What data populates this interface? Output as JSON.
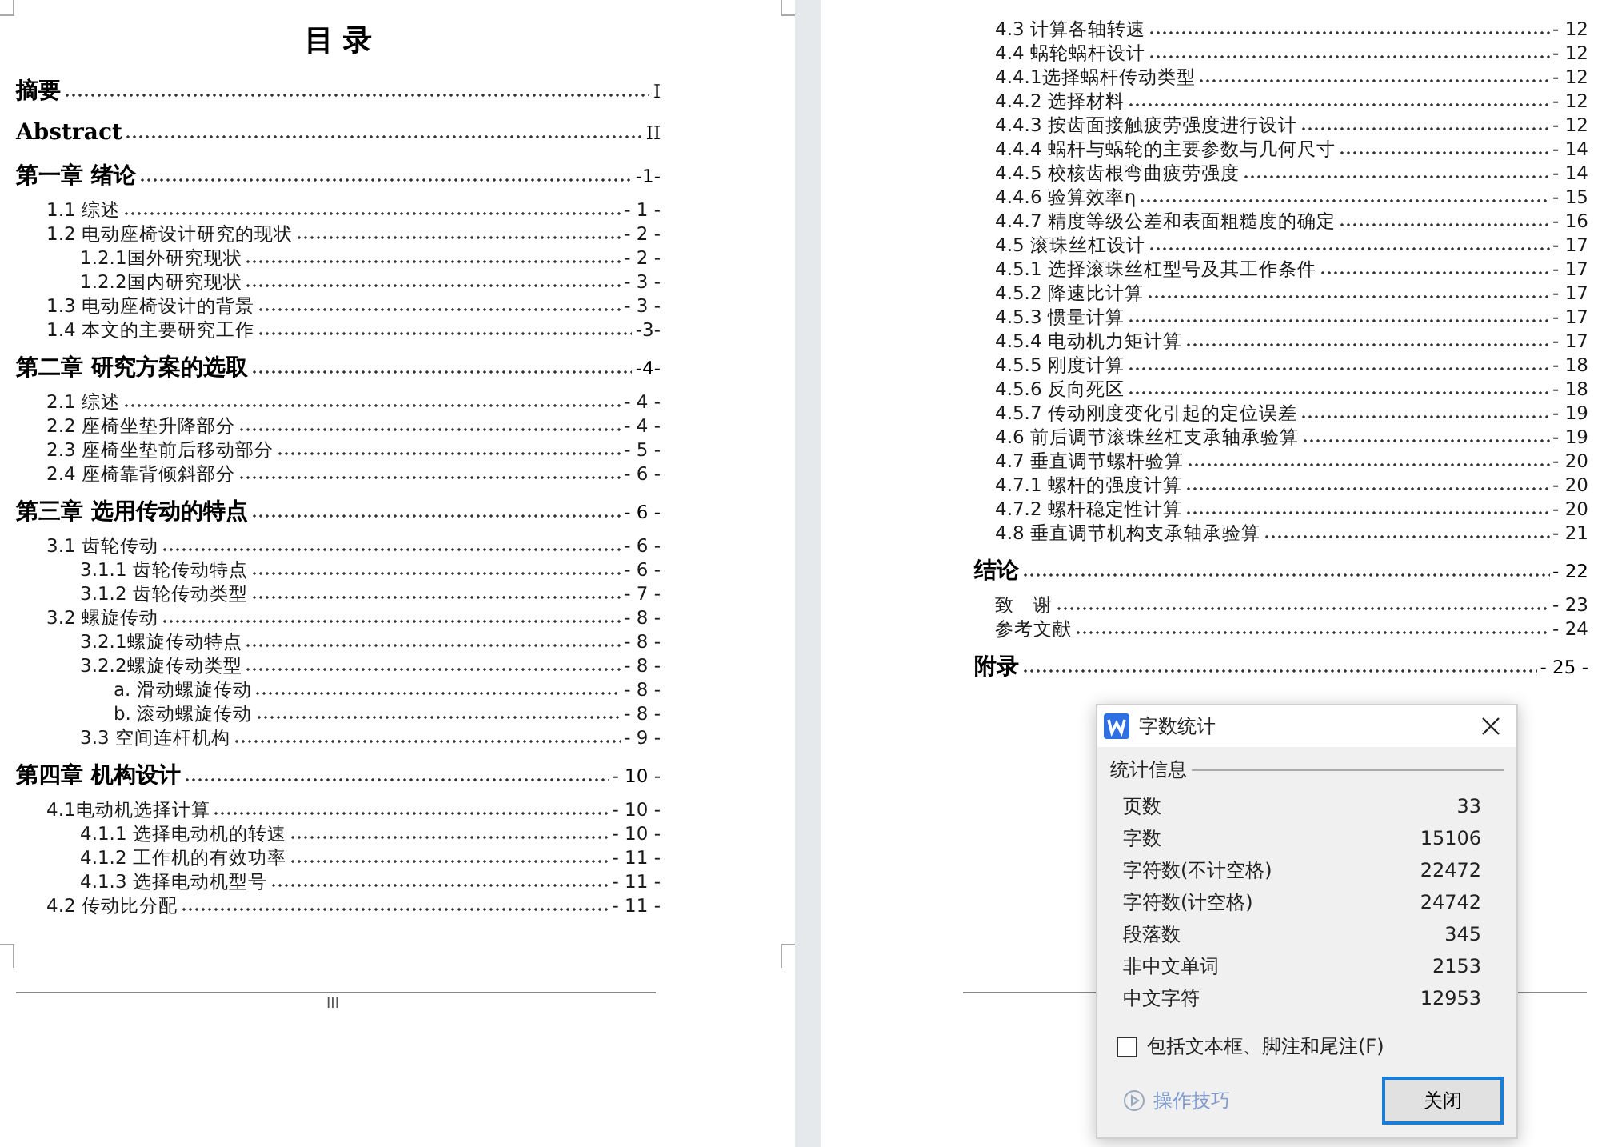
{
  "left_page": {
    "title": "目 录",
    "entries": [
      {
        "kind": "front",
        "label": "摘要",
        "page": "I"
      },
      {
        "kind": "front",
        "label": "Abstract",
        "page": "II"
      },
      {
        "kind": "chapter",
        "label": "第一章 绪论",
        "page": "-1-",
        "children": [
          {
            "kind": "section",
            "label": "1.1 综述",
            "page": "- 1 -"
          },
          {
            "kind": "section",
            "label": "1.2 电动座椅设计研究的现状",
            "page": "- 2 -",
            "children": [
              {
                "kind": "section",
                "label": "1.2.1国外研究现状",
                "page": "- 2 -"
              },
              {
                "kind": "section",
                "label": "1.2.2国内研究现状",
                "page": "- 3 -"
              }
            ]
          },
          {
            "kind": "section",
            "label": "1.3 电动座椅设计的背景",
            "page": "- 3 -"
          },
          {
            "kind": "section",
            "label": "1.4 本文的主要研究工作",
            "page": "-3-"
          }
        ]
      },
      {
        "kind": "chapter",
        "label": "第二章 研究方案的选取",
        "page": "-4-",
        "children": [
          {
            "kind": "section",
            "label": "2.1 综述",
            "page": "- 4 -"
          },
          {
            "kind": "section",
            "label": "2.2 座椅坐垫升降部分",
            "page": "- 4 -"
          },
          {
            "kind": "section",
            "label": "2.3 座椅坐垫前后移动部分",
            "page": "- 5 -"
          },
          {
            "kind": "section",
            "label": "2.4 座椅靠背倾斜部分",
            "page": "- 6 -"
          }
        ]
      },
      {
        "kind": "chapter",
        "label": "第三章 选用传动的特点",
        "page": "- 6 -",
        "children": [
          {
            "kind": "section",
            "label": "3.1 齿轮传动",
            "page": "- 6 -",
            "children": [
              {
                "kind": "section",
                "label": "3.1.1 齿轮传动特点",
                "page": "- 6 -"
              },
              {
                "kind": "section",
                "label": "3.1.2 齿轮传动类型",
                "page": "- 7 -"
              }
            ]
          },
          {
            "kind": "section",
            "label": "3.2 螺旋传动",
            "page": "- 8 -",
            "children": [
              {
                "kind": "section",
                "label": "3.2.1螺旋传动特点",
                "page": "- 8 -"
              },
              {
                "kind": "section",
                "label": "3.2.2螺旋传动类型",
                "page": "- 8 -",
                "children": [
                  {
                    "kind": "section",
                    "label": "a. 滑动螺旋传动",
                    "page": "- 8 -"
                  },
                  {
                    "kind": "section",
                    "label": "b. 滚动螺旋传动",
                    "page": "- 8 -"
                  }
                ]
              },
              {
                "kind": "section",
                "label": "3.3 空间连杆机构",
                "page": "- 9 -"
              }
            ]
          }
        ]
      },
      {
        "kind": "chapter",
        "label": "第四章 机构设计",
        "page": "- 10 -",
        "children": [
          {
            "kind": "section",
            "label": "4.1电动机选择计算",
            "page": "- 10 -",
            "children": [
              {
                "kind": "section",
                "label": "4.1.1 选择电动机的转速",
                "page": "- 10 -"
              },
              {
                "kind": "section",
                "label": "4.1.2 工作机的有效功率",
                "page": "- 11 -"
              },
              {
                "kind": "section",
                "label": "4.1.3 选择电动机型号",
                "page": "- 11 -"
              }
            ]
          },
          {
            "kind": "section",
            "label": "4.2 传动比分配",
            "page": "- 11 -"
          }
        ]
      }
    ],
    "footer": "III"
  },
  "right_page": {
    "entries": [
      {
        "kind": "section",
        "label": "4.3 计算各轴转速",
        "page": "- 12"
      },
      {
        "kind": "section",
        "label": "4.4 蜗轮蜗杆设计",
        "page": "- 12",
        "children": [
          {
            "kind": "section",
            "label": "4.4.1选择蜗杆传动类型",
            "page": "- 12"
          },
          {
            "kind": "section",
            "label": "4.4.2 选择材料",
            "page": "- 12"
          },
          {
            "kind": "section",
            "label": "4.4.3 按齿面接触疲劳强度进行设计",
            "page": "- 12"
          },
          {
            "kind": "section",
            "label": "4.4.4 蜗杆与蜗轮的主要参数与几何尺寸",
            "page": "- 14"
          },
          {
            "kind": "section",
            "label": "4.4.5 校核齿根弯曲疲劳强度",
            "page": "- 14"
          },
          {
            "kind": "section",
            "label": "4.4.6 验算效率η",
            "page": "- 15"
          },
          {
            "kind": "section",
            "label": "4.4.7 精度等级公差和表面粗糙度的确定",
            "page": "- 16"
          }
        ]
      },
      {
        "kind": "section",
        "label": "4.5 滚珠丝杠设计",
        "page": "- 17",
        "children": [
          {
            "kind": "section",
            "label": "4.5.1 选择滚珠丝杠型号及其工作条件",
            "page": "- 17"
          },
          {
            "kind": "section",
            "label": "4.5.2 降速比计算",
            "page": "- 17"
          },
          {
            "kind": "section",
            "label": "4.5.3 惯量计算",
            "page": "- 17"
          },
          {
            "kind": "section",
            "label": "4.5.4 电动机力矩计算",
            "page": "- 17"
          },
          {
            "kind": "section",
            "label": "4.5.5 刚度计算",
            "page": "- 18"
          },
          {
            "kind": "section",
            "label": "4.5.6 反向死区",
            "page": "- 18"
          },
          {
            "kind": "section",
            "label": "4.5.7 传动刚度变化引起的定位误差",
            "page": "- 19"
          }
        ]
      },
      {
        "kind": "section",
        "label": "4.6 前后调节滚珠丝杠支承轴承验算",
        "page": "- 19"
      },
      {
        "kind": "section",
        "label": "4.7 垂直调节螺杆验算",
        "page": "- 20",
        "children": [
          {
            "kind": "section",
            "label": "4.7.1 螺杆的强度计算",
            "page": "- 20"
          },
          {
            "kind": "section",
            "label": "4.7.2 螺杆稳定性计算",
            "page": "- 20"
          }
        ]
      },
      {
        "kind": "section",
        "label": "4.8 垂直调节机构支承轴承验算",
        "page": "- 21"
      },
      {
        "kind": "chapter",
        "label": "结论",
        "page": "- 22"
      },
      {
        "kind": "section",
        "label": "致　谢",
        "page": "- 23"
      },
      {
        "kind": "section",
        "label": "参考文献",
        "page": "- 24"
      },
      {
        "kind": "chapter",
        "label": "附录",
        "page": "- 25 -"
      }
    ]
  },
  "word_count_dialog": {
    "title": "字数统计",
    "group_label": "统计信息",
    "stats": [
      {
        "label": "页数",
        "value": "33"
      },
      {
        "label": "字数",
        "value": "15106"
      },
      {
        "label": "字符数(不计空格)",
        "value": "22472"
      },
      {
        "label": "字符数(计空格)",
        "value": "24742"
      },
      {
        "label": "段落数",
        "value": "345"
      },
      {
        "label": "非中文单词",
        "value": "2153"
      },
      {
        "label": "中文字符",
        "value": "12953"
      }
    ],
    "checkbox": {
      "label": "包括文本框、脚注和尾注(F)",
      "checked": false
    },
    "tips_link": "操作技巧",
    "close_button": "关闭"
  }
}
